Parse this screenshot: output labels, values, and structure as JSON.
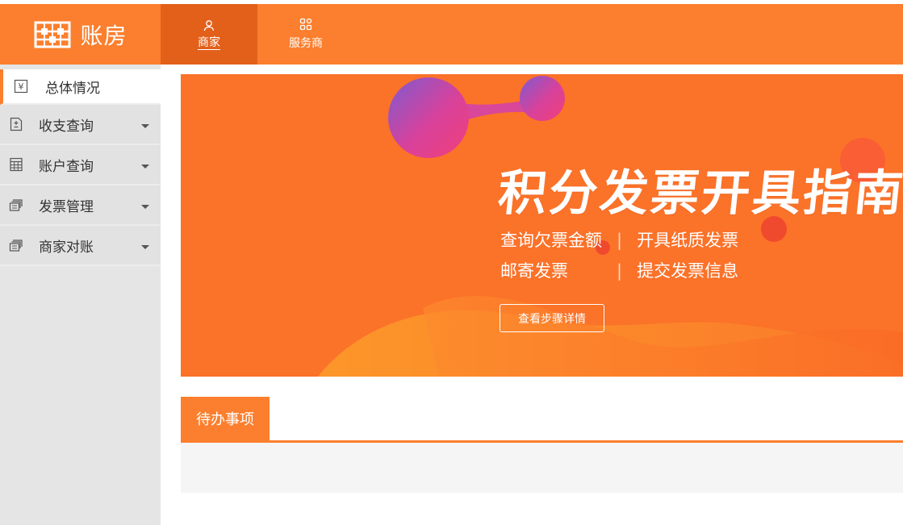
{
  "brand": {
    "name": "账房",
    "icon": "abacus-icon"
  },
  "nav": {
    "tabs": [
      {
        "label": "商家",
        "icon": "user-icon",
        "active": true
      },
      {
        "label": "服务商",
        "icon": "apps-grid-icon",
        "active": false
      }
    ]
  },
  "sidebar": {
    "items": [
      {
        "label": "总体情况",
        "icon": "yen-icon",
        "active": true,
        "expandable": false
      },
      {
        "label": "收支查询",
        "icon": "document-plus-minus-icon",
        "active": false,
        "expandable": true
      },
      {
        "label": "账户查询",
        "icon": "calculator-icon",
        "active": false,
        "expandable": true
      },
      {
        "label": "发票管理",
        "icon": "stacked-cards-icon",
        "active": false,
        "expandable": true
      },
      {
        "label": "商家对账",
        "icon": "stacked-cards-icon",
        "active": false,
        "expandable": true
      }
    ]
  },
  "banner": {
    "title": "积分发票开具指南",
    "line1": {
      "left": "查询欠票金额",
      "separator": "|",
      "right": "开具纸质发票"
    },
    "line2": {
      "left": "邮寄发票",
      "separator": "|",
      "right": "提交发票信息"
    },
    "button_label": "查看步骤详情"
  },
  "todo": {
    "tab_label": "待办事项"
  },
  "colors": {
    "accent": "#fb7f2e",
    "accent_dark": "#e3601a",
    "sidebar_bg": "#e5e5e6"
  }
}
